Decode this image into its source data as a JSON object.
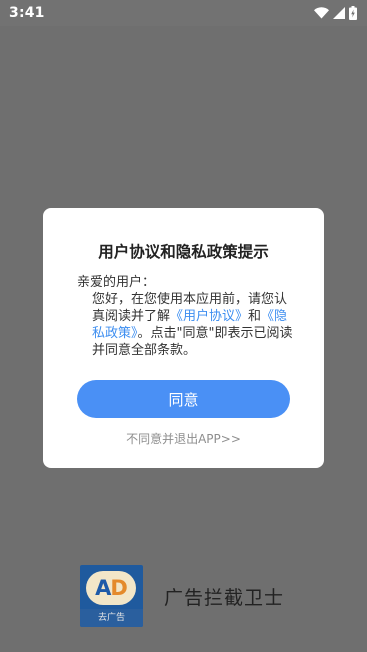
{
  "status_bar": {
    "time": "3:41",
    "icons": [
      "wifi-icon",
      "cell-signal-icon",
      "battery-charging-icon"
    ]
  },
  "dialog": {
    "title": "用户协议和隐私政策提示",
    "greeting": "亲爱的用户：",
    "body_part1": "您好，在您使用本应用前，请您认真阅读并了解",
    "user_agreement_link": "《用户协议》",
    "body_and": "和",
    "privacy_policy_link": "《隐私政策》",
    "body_part2": "。点击\"同意\"即表示已阅读并同意全部条款。",
    "agree_label": "同意",
    "decline_label": "不同意并退出APP>>"
  },
  "splash": {
    "logo_text_a": "A",
    "logo_text_d": "D",
    "logo_caption": "去广告",
    "app_name": "广告拦截卫士"
  },
  "colors": {
    "accent": "#4a90f5",
    "link": "#3d8ef0",
    "overlay": "#6f6f6f"
  }
}
